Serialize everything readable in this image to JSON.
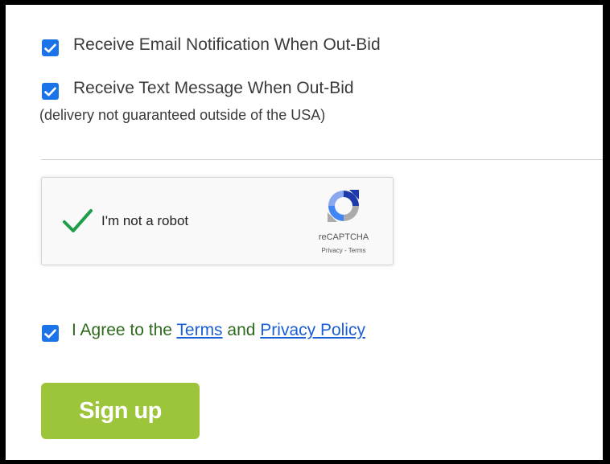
{
  "options": {
    "email": {
      "label": "Receive Email Notification When Out-Bid",
      "checked": true
    },
    "text": {
      "label": "Receive Text Message When Out-Bid",
      "checked": true,
      "note": "(delivery not guaranteed outside of the USA)"
    }
  },
  "recaptcha": {
    "label": "I'm not a robot",
    "brand": "reCAPTCHA",
    "privacy": "Privacy",
    "separator": " - ",
    "terms": "Terms",
    "logo_icon": "recaptcha-logo-icon",
    "check_icon": "checkmark-icon"
  },
  "agree": {
    "prefix": "I Agree to the ",
    "terms_link": "Terms",
    "middle": " and ",
    "privacy_link": "Privacy Policy",
    "checked": true
  },
  "signup": {
    "label": "Sign up"
  },
  "colors": {
    "checkbox": "#1a73e8",
    "agree_text": "#2e6b1f",
    "link": "#1a5fd6",
    "signup_bg": "#9dc53b",
    "recaptcha_check": "#1e9e48"
  }
}
